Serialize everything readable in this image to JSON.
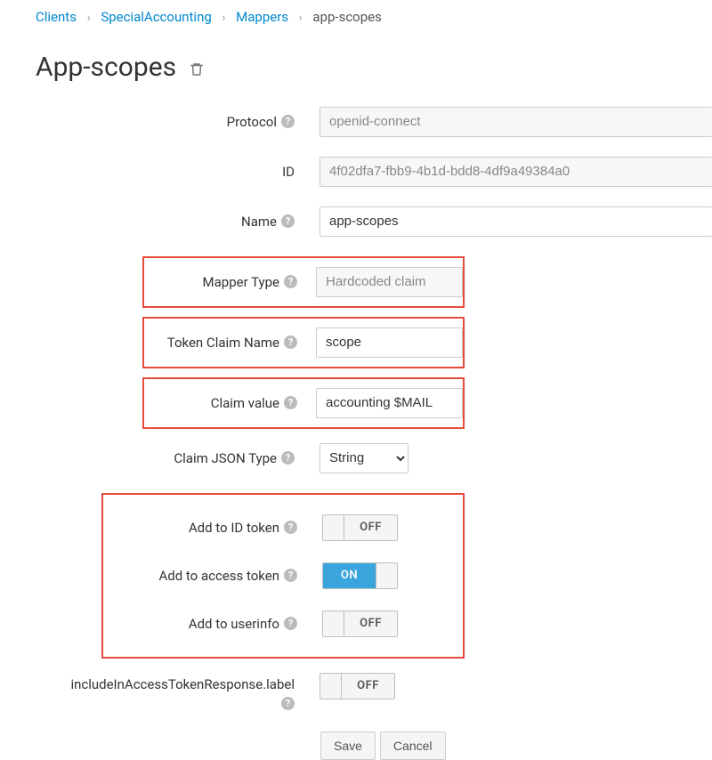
{
  "breadcrumb": {
    "items": [
      "Clients",
      "SpecialAccounting",
      "Mappers"
    ],
    "current": "app-scopes"
  },
  "page": {
    "title": "App-scopes"
  },
  "fields": {
    "protocol_label": "Protocol",
    "protocol_value": "openid-connect",
    "id_label": "ID",
    "id_value": "4f02dfa7-fbb9-4b1d-bdd8-4df9a49384a0",
    "name_label": "Name",
    "name_value": "app-scopes",
    "mapper_type_label": "Mapper Type",
    "mapper_type_value": "Hardcoded claim",
    "token_claim_name_label": "Token Claim Name",
    "token_claim_name_value": "scope",
    "claim_value_label": "Claim value",
    "claim_value_value": "accounting $MAIL",
    "claim_json_type_label": "Claim JSON Type",
    "claim_json_type_value": "String",
    "add_id_token_label": "Add to ID token",
    "add_access_token_label": "Add to access token",
    "add_userinfo_label": "Add to userinfo",
    "include_access_token_response_label": "includeInAccessTokenResponse.label"
  },
  "toggles": {
    "add_id_token": {
      "on": false,
      "label": "OFF"
    },
    "add_access_token": {
      "on": true,
      "label": "ON"
    },
    "add_userinfo": {
      "on": false,
      "label": "OFF"
    },
    "include_access_token_response": {
      "on": false,
      "label": "OFF"
    }
  },
  "buttons": {
    "save": "Save",
    "cancel": "Cancel"
  }
}
